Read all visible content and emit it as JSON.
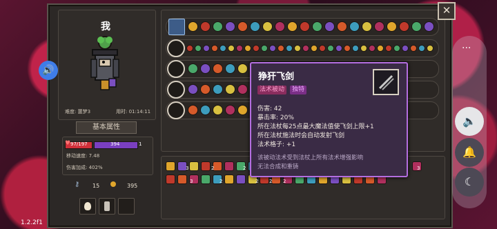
{
  "header": {
    "character_name": "我"
  },
  "character": {
    "difficulty_label": "难度: 噩梦3",
    "time_label": "用时: 01:14:11",
    "attributes_button": "基本属性",
    "hp_text": "97/197",
    "mana_text": "394",
    "level_text": "1",
    "move_speed": "移动速度: 7.48",
    "damage_bonus": "伤害加成: 402%",
    "keys": "15",
    "coins": "395"
  },
  "inventory_counts": [
    "3",
    "2",
    "2",
    "3",
    "2",
    "2",
    "2",
    "3",
    "2"
  ],
  "tooltip": {
    "title": "狰犴飞剑",
    "tags": [
      "法术被动",
      "独特"
    ],
    "lines": [
      "伤害: 42",
      "暴击率: 20%",
      "所在法杖每25点最大魔法值使飞剑上限+1",
      "所在法杖施法时会自动发射飞剑",
      "法术格子: +1"
    ],
    "notes": [
      "该被动法术受到法杖上所有法术增强影响",
      "无法合成和重铸"
    ]
  },
  "system": {
    "version": "1.2.2f1",
    "close_label": "✕",
    "more_label": "···"
  },
  "colors": {
    "hp": "#d0303a",
    "mana": "#7a3fc0",
    "tooltip_border": "#b46ee0",
    "accent_blue": "#3f7de8"
  }
}
